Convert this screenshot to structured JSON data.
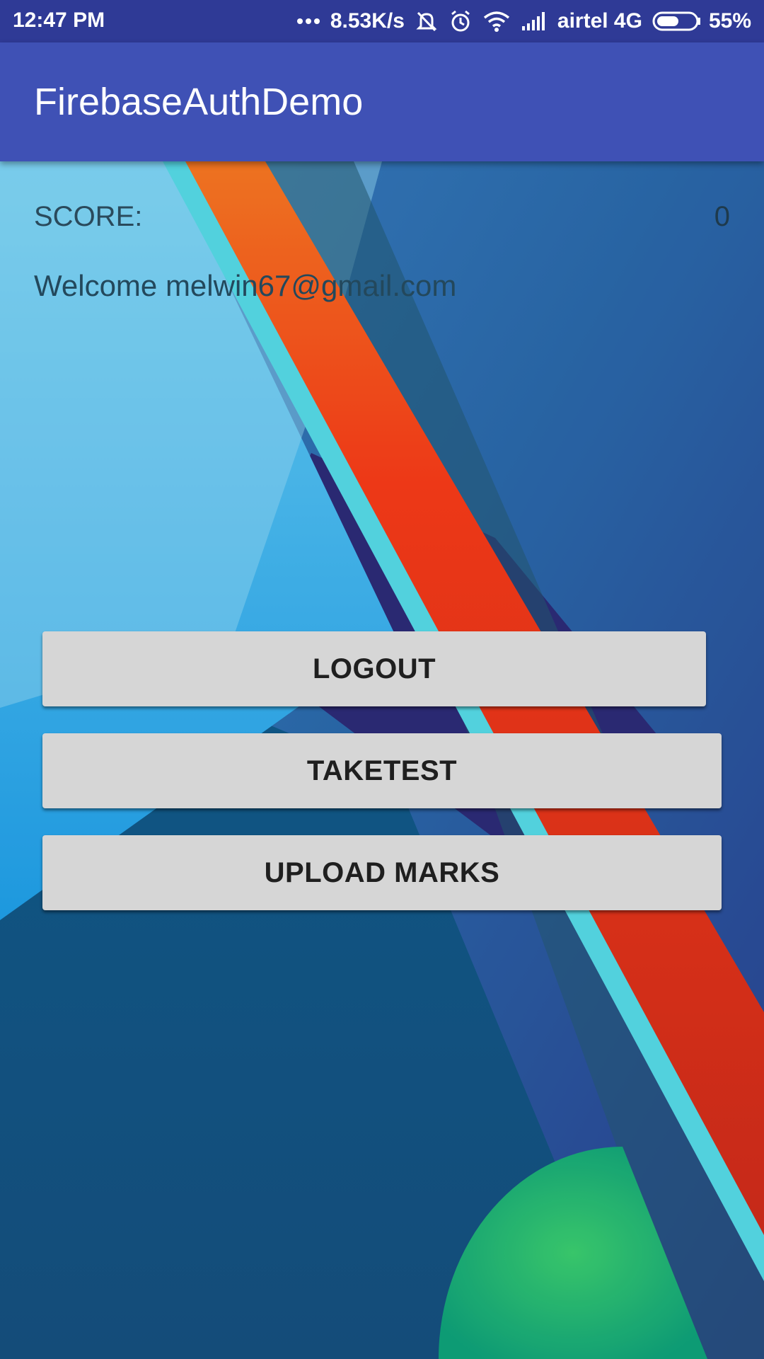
{
  "status_bar": {
    "time": "12:47 PM",
    "network_speed": "8.53K/s",
    "carrier": "airtel 4G",
    "battery_percent": "55%",
    "battery_level": 0.55,
    "icons": [
      "more-dots-icon",
      "muted-bell-icon",
      "alarm-icon",
      "wifi-icon",
      "signal-icon",
      "battery-icon"
    ]
  },
  "app_bar": {
    "title": "FirebaseAuthDemo",
    "color": "#3f51b5"
  },
  "main": {
    "score_label": "SCORE:",
    "score_value": "0",
    "welcome_text": "Welcome melwin67@gmail.com",
    "buttons": [
      {
        "label": "LOGOUT"
      },
      {
        "label": "TAKETEST"
      },
      {
        "label": "UPLOAD MARKS"
      }
    ]
  },
  "colors": {
    "status_bar": "#2f3a96",
    "button_bg": "#d6d6d6",
    "button_text": "#1f1f1f"
  }
}
